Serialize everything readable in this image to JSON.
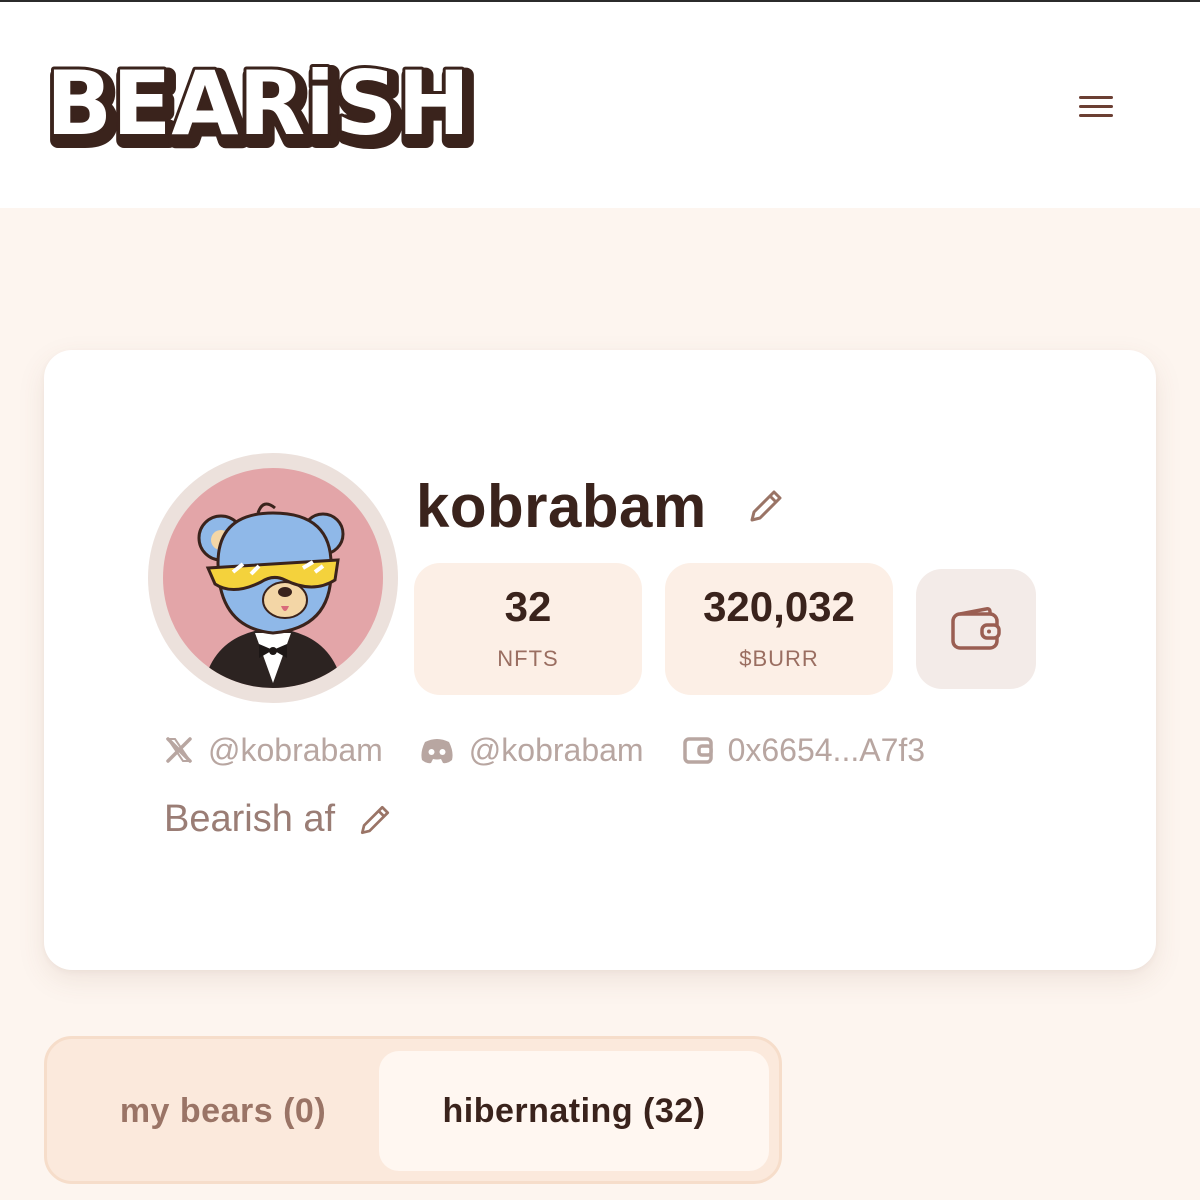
{
  "header": {
    "logo_text": "BEARiSH",
    "menu_icon": "hamburger-menu-icon"
  },
  "profile": {
    "username": "kobrabam",
    "avatar_icon": "bear-with-sunglasses-avatar",
    "stats": [
      {
        "value": "32",
        "label": "NFTS"
      },
      {
        "value": "320,032",
        "label": "$BURR"
      }
    ],
    "wallet_button_icon": "wallet-icon",
    "socials": {
      "x_handle": "@kobrabam",
      "discord_handle": "@kobrabam",
      "wallet_address": "0x6654...A7f3"
    },
    "bio": "Bearish af"
  },
  "tabs": [
    {
      "label": "my bears (0)",
      "active": false
    },
    {
      "label": "hibernating (32)",
      "active": true
    }
  ],
  "colors": {
    "background": "#fdf5ef",
    "card": "#ffffff",
    "stat_bg": "#fcefe6",
    "text_dark": "#3a231c",
    "text_muted": "#b8a6a1",
    "accent_brown": "#6b3f33"
  }
}
